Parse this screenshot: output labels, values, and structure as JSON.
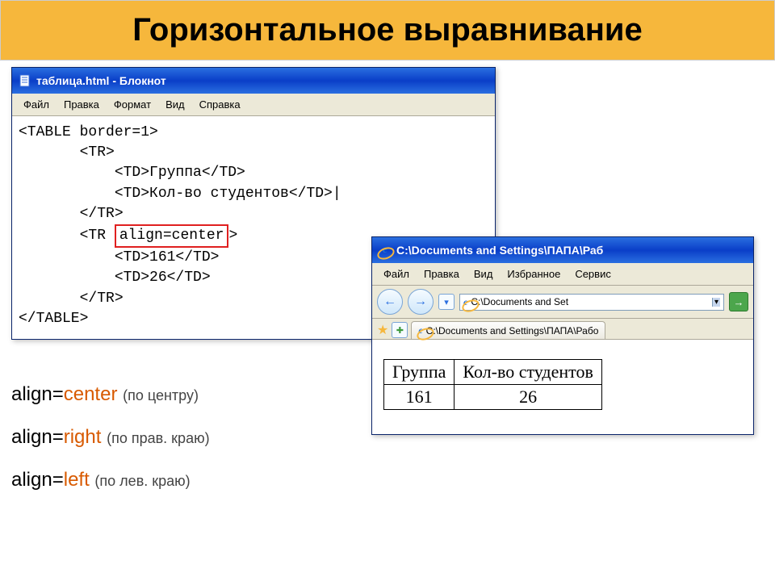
{
  "slide": {
    "title": "Горизонтальное выравнивание"
  },
  "notepad": {
    "title": "таблица.html - Блокнот",
    "menu": {
      "file": "Файл",
      "edit": "Правка",
      "format": "Формат",
      "view": "Вид",
      "help": "Справка"
    },
    "code": {
      "l1": "<TABLE border=1>",
      "l2": "       <TR>",
      "l3": "           <TD>Группа</TD>",
      "l4": "           <TD>Кол-во студентов</TD>|",
      "l5": "       </TR>",
      "l6a": "       <TR ",
      "l6b": "align=center",
      "l6c": ">",
      "l7": "           <TD>161</TD>",
      "l8": "           <TD>26</TD>",
      "l9": "       </TR>",
      "l10": "</TABLE>"
    }
  },
  "ie": {
    "title": "C:\\Documents and Settings\\ПАПА\\Раб",
    "menu": {
      "file": "Файл",
      "edit": "Правка",
      "view": "Вид",
      "fav": "Избранное",
      "tools": "Сервис"
    },
    "addr_short": "C:\\Documents and Set",
    "tab_label": "C:\\Documents and Settings\\ПАПА\\Рабо",
    "table": {
      "h1": "Группа",
      "h2": "Кол-во студентов",
      "c1": "161",
      "c2": "26"
    }
  },
  "legend": {
    "kw": "align=",
    "center": "center",
    "center_ru": "(по центру)",
    "right": "right",
    "right_ru": "(по прав. краю)",
    "left": "left",
    "left_ru": "(по лев. краю)"
  }
}
